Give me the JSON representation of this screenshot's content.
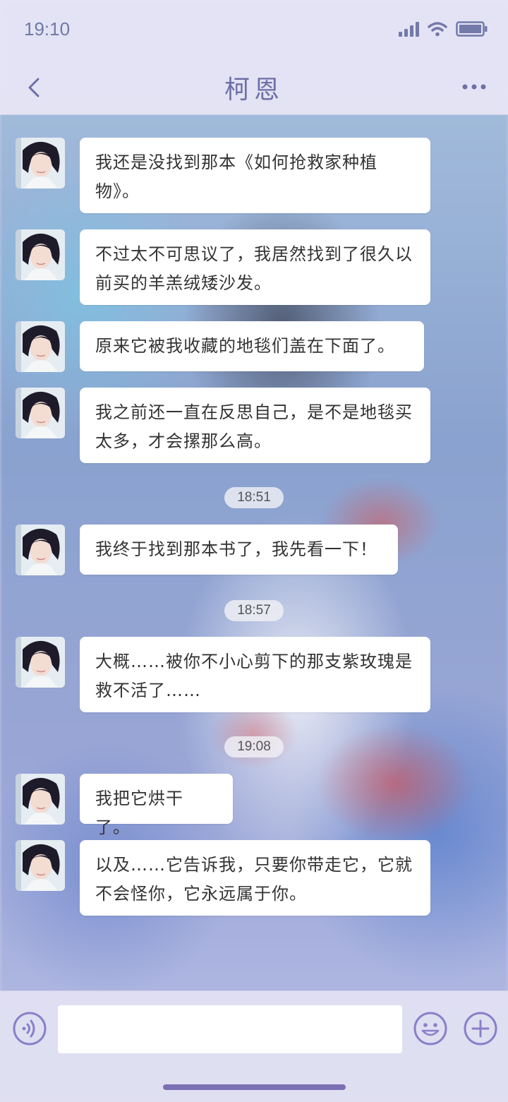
{
  "status_bar": {
    "time": "19:10"
  },
  "header": {
    "title": "柯恩"
  },
  "messages": [
    {
      "type": "msg",
      "text": "我还是没找到那本《如何抢救家种植物》。"
    },
    {
      "type": "msg",
      "text": "不过太不可思议了，我居然找到了很久以前买的羊羔绒矮沙发。"
    },
    {
      "type": "msg",
      "text": "原来它被我收藏的地毯们盖在下面了。"
    },
    {
      "type": "msg",
      "text": "我之前还一直在反思自己，是不是地毯买太多，才会摞那么高。"
    },
    {
      "type": "time",
      "text": "18:51"
    },
    {
      "type": "msg",
      "text": "我终于找到那本书了，我先看一下！"
    },
    {
      "type": "time",
      "text": "18:57"
    },
    {
      "type": "msg",
      "text": "大概……被你不小心剪下的那支紫玫瑰是救不活了……"
    },
    {
      "type": "time",
      "text": "19:08"
    },
    {
      "type": "msg",
      "text": "我把它烘干了。"
    },
    {
      "type": "msg",
      "text": "以及……它告诉我，只要你带走它，它就不会怪你，它永远属于你。"
    }
  ],
  "input": {
    "value": "",
    "placeholder": ""
  },
  "colors": {
    "accent": "#6f6fa8",
    "bubble": "#ffffff",
    "bar": "#e8e6f6"
  },
  "icons": [
    "back-icon",
    "more-icon",
    "signal-icon",
    "wifi-icon",
    "battery-icon",
    "voice-icon",
    "emoji-icon",
    "plus-icon"
  ]
}
